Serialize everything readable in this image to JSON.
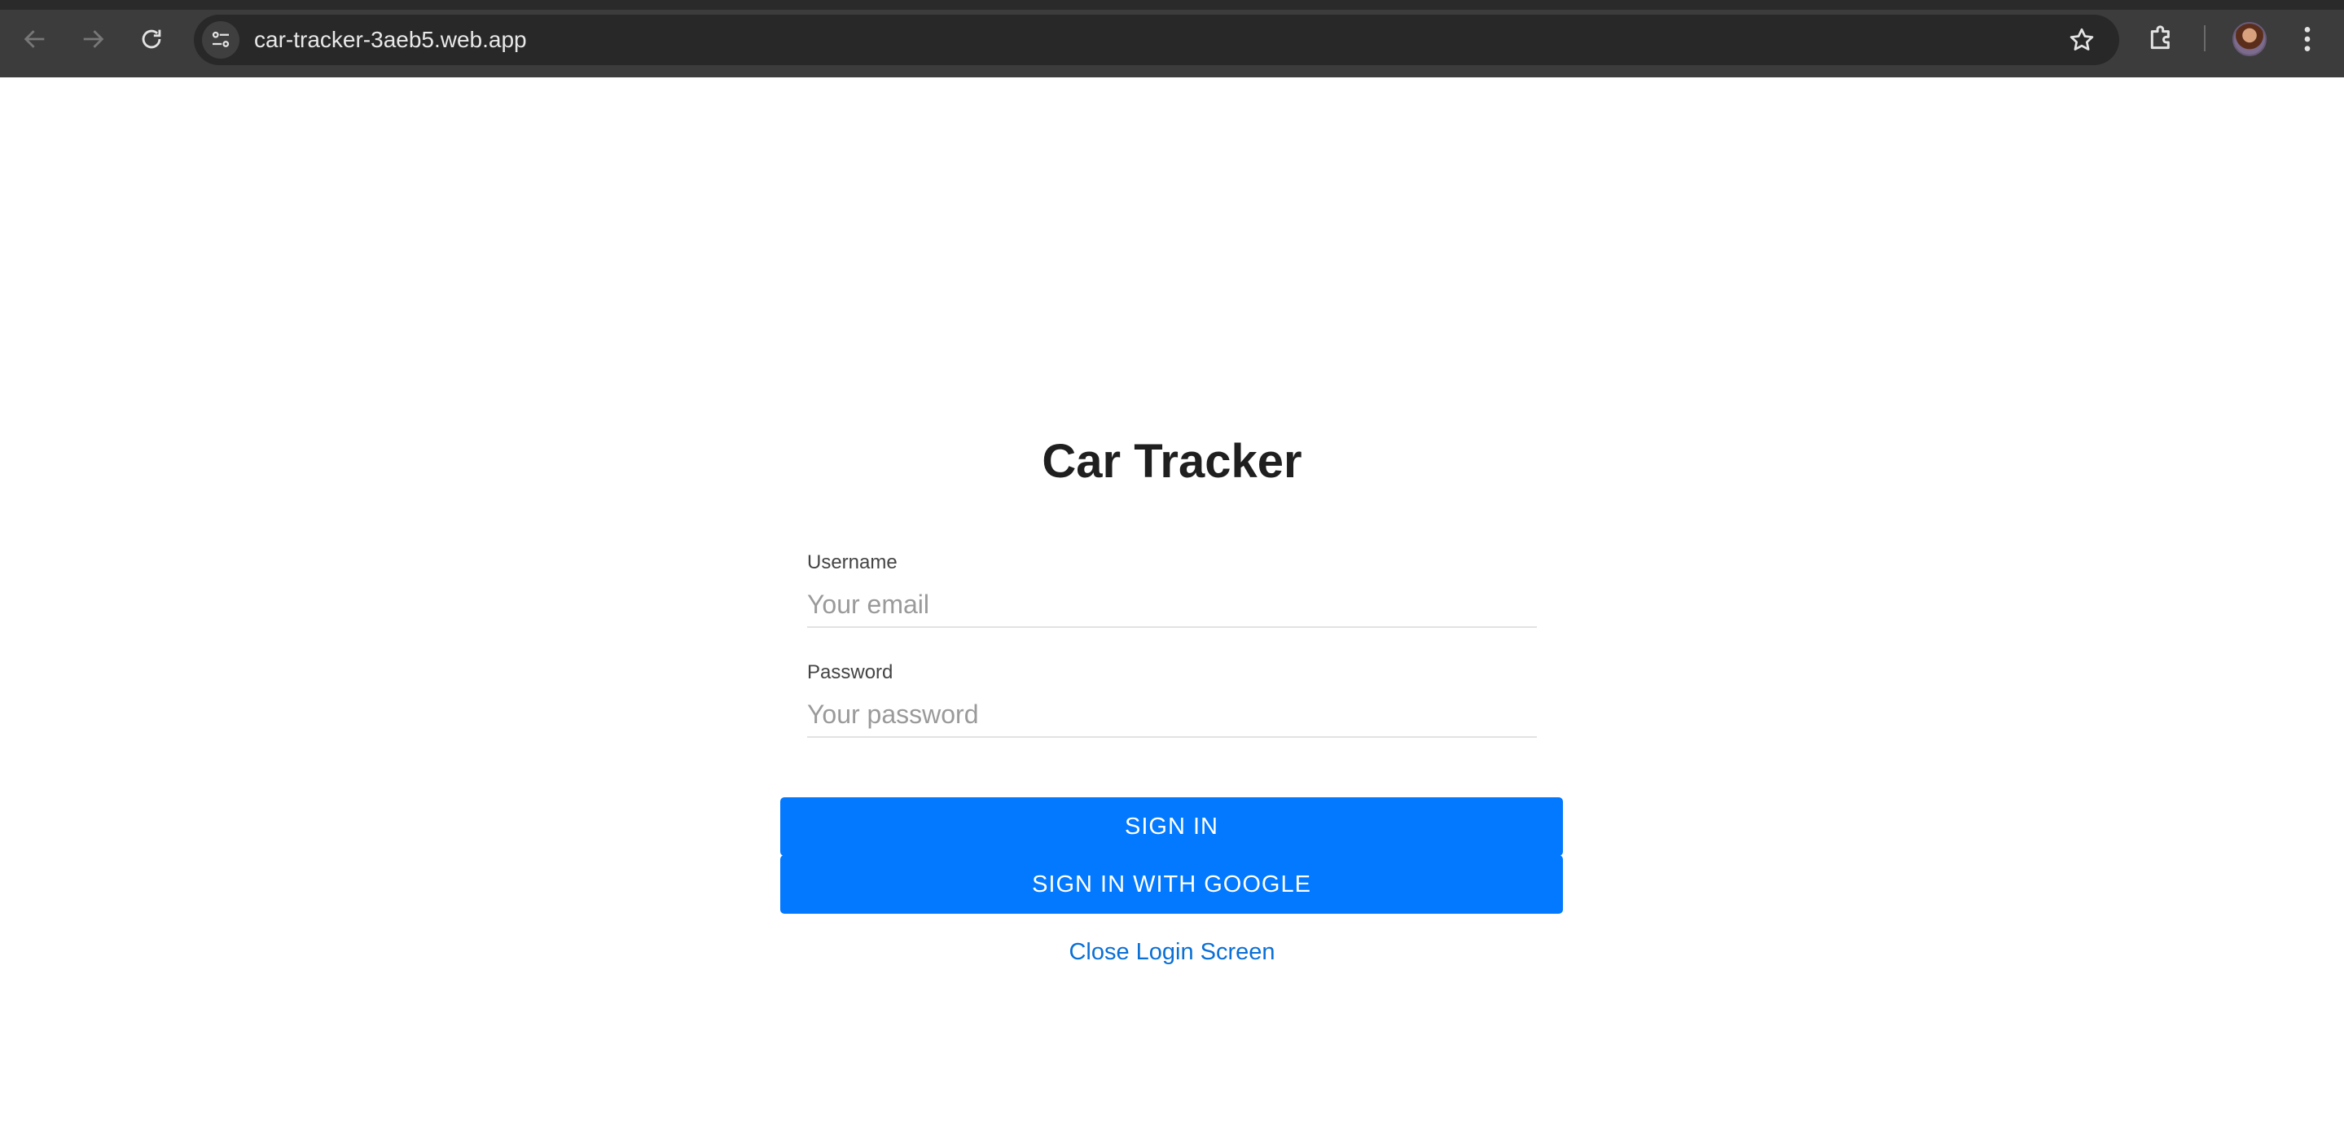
{
  "browser": {
    "url": "car-tracker-3aeb5.web.app",
    "icons": {
      "back": "back-arrow-icon",
      "forward": "forward-arrow-icon",
      "reload": "reload-icon",
      "site_info": "site-info-icon",
      "bookmark": "star-icon",
      "extensions": "puzzle-icon",
      "profile": "avatar",
      "menu": "kebab-menu-icon"
    }
  },
  "login": {
    "title": "Car Tracker",
    "username_label": "Username",
    "username_placeholder": "Your email",
    "password_label": "Password",
    "password_placeholder": "Your password",
    "sign_in_label": "SIGN IN",
    "google_label": "SIGN IN WITH GOOGLE",
    "close_label": "Close Login Screen"
  },
  "colors": {
    "primary_button": "#0279fe",
    "link": "#0a6fd6",
    "chrome_bg": "#3c3c3c"
  }
}
